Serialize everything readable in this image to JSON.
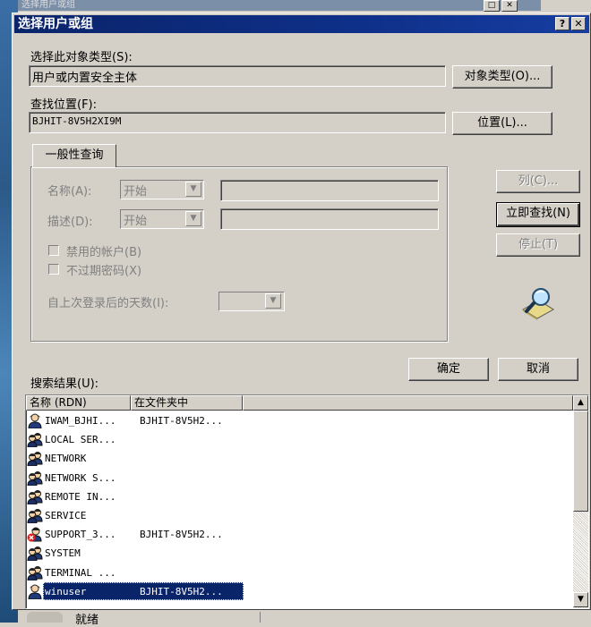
{
  "background_window": {
    "title": "选择用户或组",
    "status_text": "就绪"
  },
  "dialog": {
    "title": "选择用户或组",
    "help_button": "?",
    "close_button": "✕",
    "object_type_label": "选择此对象类型(S):",
    "object_type_value": "用户或内置安全主体",
    "object_type_button": "对象类型(O)...",
    "location_label": "查找位置(F):",
    "location_value": "BJHIT-8V5H2XI9M",
    "location_button": "位置(L)...",
    "tab_label": "一般性查询",
    "name_label": "名称(A):",
    "name_combo": "开始",
    "desc_label": "描述(D):",
    "desc_combo": "开始",
    "disabled_accounts": "禁用的帐户(B)",
    "nonexpiring_password": "不过期密码(X)",
    "days_since_logon": "自上次登录后的天数(I):",
    "columns_button": "列(C)...",
    "find_now_button": "立即查找(N)",
    "stop_button": "停止(T)",
    "ok_button": "确定",
    "cancel_button": "取消",
    "results_label": "搜索结果(U):"
  },
  "results": {
    "columns": [
      "名称 (RDN)",
      "在文件夹中"
    ],
    "rows": [
      {
        "name": "IWAM_BJHI...",
        "folder": "BJHIT-8V5H2...",
        "icon": "user-icon"
      },
      {
        "name": "LOCAL SER...",
        "folder": "",
        "icon": "group-icon"
      },
      {
        "name": "NETWORK",
        "folder": "",
        "icon": "group-icon"
      },
      {
        "name": "NETWORK S...",
        "folder": "",
        "icon": "group-icon"
      },
      {
        "name": "REMOTE IN...",
        "folder": "",
        "icon": "group-icon"
      },
      {
        "name": "SERVICE",
        "folder": "",
        "icon": "group-icon"
      },
      {
        "name": "SUPPORT_3...",
        "folder": "BJHIT-8V5H2...",
        "icon": "disabled-user-icon"
      },
      {
        "name": "SYSTEM",
        "folder": "",
        "icon": "group-icon"
      },
      {
        "name": "TERMINAL ...",
        "folder": "",
        "icon": "group-icon"
      },
      {
        "name": "winuser",
        "folder": "BJHIT-8V5H2...",
        "icon": "user-icon",
        "selected": true
      }
    ]
  },
  "colors": {
    "titlebar": "#0a246a",
    "face": "#d4d0c8",
    "selection": "#0a246a"
  }
}
